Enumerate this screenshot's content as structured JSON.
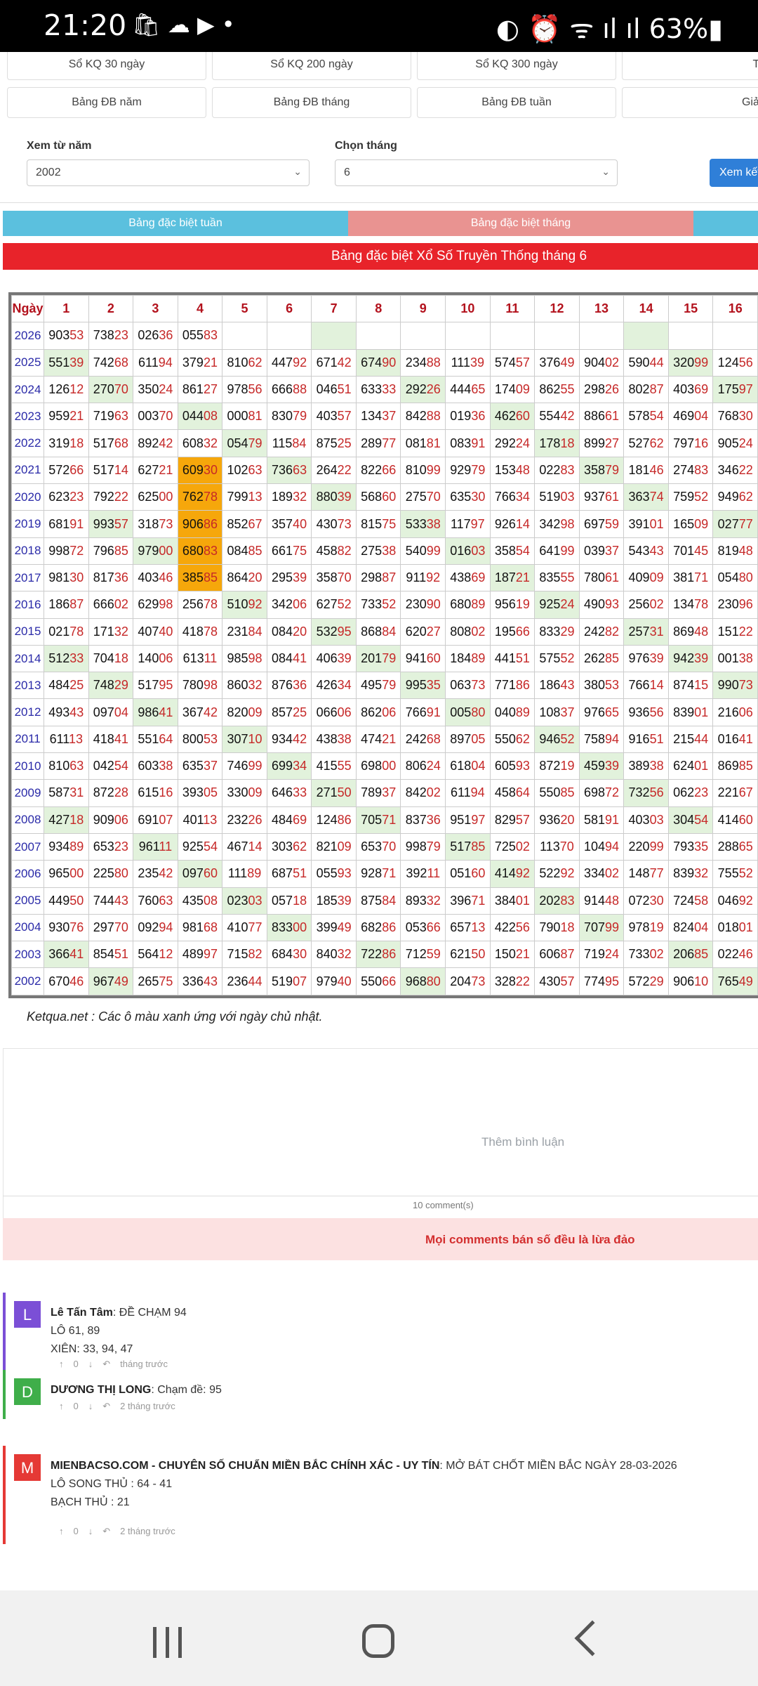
{
  "status_bar": {
    "time": "21:20",
    "left_icons": "🛍 ☁ ▶ •",
    "right_text": "◐ ⏰ ᯤ ıl ıl 63%▮"
  },
  "buttons_row1": [
    "Sổ KQ 30 ngày",
    "Sổ KQ 200 ngày",
    "Sổ KQ 300 ngày",
    "Tần suất loto"
  ],
  "buttons_row2": [
    "Bảng ĐB năm",
    "Bảng ĐB tháng",
    "Bảng ĐB tuần",
    "Giải ĐB ngày m"
  ],
  "filter": {
    "year_label": "Xem từ năm",
    "year_value": "2002",
    "month_label": "Chọn tháng",
    "month_value": "6",
    "go_label": "Xem kết"
  },
  "tabs": {
    "week": "Bảng đặc biệt tuần",
    "month": "Bảng đặc biệt tháng"
  },
  "banner": "Bảng đặc biệt Xổ Số Truyền Thống tháng 6",
  "colors": {
    "green_cell": "#e2f2dc",
    "orange_cell": "#f6a70b",
    "tab_blue": "#5bc0de",
    "tab_pink": "#e99391",
    "banner_red": "#e8232a"
  },
  "table": {
    "header": [
      "Ngày",
      "1",
      "2",
      "3",
      "4",
      "5",
      "6",
      "7",
      "8",
      "9",
      "10",
      "11",
      "12",
      "13",
      "14",
      "15",
      "16"
    ],
    "rows": [
      {
        "year": "2026",
        "values": [
          "90353",
          "73823",
          "02636",
          "05583",
          "",
          "",
          "",
          "",
          "",
          "",
          "",
          "",
          "",
          "",
          "",
          ""
        ],
        "green": [
          6,
          13
        ],
        "orange": []
      },
      {
        "year": "2025",
        "values": [
          "55139",
          "74268",
          "61194",
          "37921",
          "81062",
          "44792",
          "67142",
          "67490",
          "23488",
          "11139",
          "57457",
          "37649",
          "90402",
          "59044",
          "32099",
          "12456"
        ],
        "green": [
          0,
          7,
          14
        ],
        "orange": []
      },
      {
        "year": "2024",
        "values": [
          "12612",
          "27070",
          "35024",
          "86127",
          "97856",
          "66688",
          "04651",
          "63333",
          "29226",
          "44465",
          "17409",
          "86255",
          "29826",
          "80287",
          "40369",
          "17597"
        ],
        "green": [
          1,
          8,
          15
        ],
        "orange": []
      },
      {
        "year": "2023",
        "values": [
          "95921",
          "71963",
          "00370",
          "04408",
          "00081",
          "83079",
          "40357",
          "13437",
          "84288",
          "01936",
          "46260",
          "55442",
          "88661",
          "57854",
          "46904",
          "76830"
        ],
        "green": [
          3,
          10
        ],
        "orange": []
      },
      {
        "year": "2022",
        "values": [
          "31918",
          "51768",
          "89242",
          "60832",
          "05479",
          "11584",
          "87525",
          "28977",
          "08181",
          "08391",
          "29224",
          "17818",
          "89927",
          "52762",
          "79716",
          "90524"
        ],
        "green": [
          4,
          11
        ],
        "orange": []
      },
      {
        "year": "2021",
        "values": [
          "57266",
          "51714",
          "62721",
          "60930",
          "10263",
          "73663",
          "26422",
          "82266",
          "81099",
          "92979",
          "15348",
          "02283",
          "35879",
          "18146",
          "27483",
          "34622"
        ],
        "green": [
          5,
          12
        ],
        "orange": [
          3
        ]
      },
      {
        "year": "2020",
        "values": [
          "62323",
          "79222",
          "62500",
          "76278",
          "79913",
          "18932",
          "88039",
          "56860",
          "27570",
          "63530",
          "76634",
          "51903",
          "93761",
          "36374",
          "75952",
          "94962"
        ],
        "green": [
          6,
          13
        ],
        "orange": [
          3
        ]
      },
      {
        "year": "2019",
        "values": [
          "68191",
          "99357",
          "31873",
          "90686",
          "85267",
          "35740",
          "43073",
          "81575",
          "53338",
          "11797",
          "92614",
          "34298",
          "69759",
          "39101",
          "16509",
          "02777"
        ],
        "green": [
          1,
          8,
          15
        ],
        "orange": [
          3
        ]
      },
      {
        "year": "2018",
        "values": [
          "99872",
          "79685",
          "97900",
          "68083",
          "08485",
          "66175",
          "45882",
          "27538",
          "54099",
          "01603",
          "35854",
          "64199",
          "03937",
          "54343",
          "70145",
          "81948"
        ],
        "green": [
          2,
          9
        ],
        "orange": [
          3
        ]
      },
      {
        "year": "2017",
        "values": [
          "98130",
          "81736",
          "40346",
          "38585",
          "86420",
          "29539",
          "35870",
          "29887",
          "91192",
          "43869",
          "18721",
          "83555",
          "78061",
          "40909",
          "38171",
          "05480"
        ],
        "green": [
          10
        ],
        "orange": [
          3
        ]
      },
      {
        "year": "2016",
        "values": [
          "18687",
          "66602",
          "62998",
          "25678",
          "51092",
          "34206",
          "62752",
          "73352",
          "23090",
          "68089",
          "95619",
          "92524",
          "49093",
          "25602",
          "13478",
          "23096"
        ],
        "green": [
          4,
          11
        ],
        "orange": []
      },
      {
        "year": "2015",
        "values": [
          "02178",
          "17132",
          "40740",
          "41878",
          "23184",
          "08420",
          "53295",
          "86884",
          "62027",
          "80802",
          "19566",
          "83329",
          "24282",
          "25731",
          "86948",
          "15122"
        ],
        "green": [
          6,
          13
        ],
        "orange": []
      },
      {
        "year": "2014",
        "values": [
          "51233",
          "70418",
          "14006",
          "61311",
          "98598",
          "08441",
          "40639",
          "20179",
          "94160",
          "18489",
          "44151",
          "57552",
          "26285",
          "97639",
          "94239",
          "00138"
        ],
        "green": [
          0,
          7,
          14
        ],
        "orange": []
      },
      {
        "year": "2013",
        "values": [
          "48425",
          "74829",
          "51795",
          "78098",
          "86032",
          "87636",
          "42634",
          "49579",
          "99535",
          "06373",
          "77186",
          "18643",
          "38053",
          "76614",
          "87415",
          "99073"
        ],
        "green": [
          1,
          8,
          15
        ],
        "orange": []
      },
      {
        "year": "2012",
        "values": [
          "49343",
          "09704",
          "98641",
          "36742",
          "82009",
          "85725",
          "06606",
          "86206",
          "76691",
          "00580",
          "04089",
          "10837",
          "97665",
          "93656",
          "83901",
          "21606"
        ],
        "green": [
          2,
          9
        ],
        "orange": []
      },
      {
        "year": "2011",
        "values": [
          "61113",
          "41841",
          "55164",
          "80053",
          "30710",
          "93442",
          "43838",
          "47421",
          "24268",
          "89705",
          "55062",
          "94652",
          "75894",
          "91651",
          "21544",
          "01641"
        ],
        "green": [
          4,
          11
        ],
        "orange": []
      },
      {
        "year": "2010",
        "values": [
          "81063",
          "04254",
          "60338",
          "63537",
          "74699",
          "69934",
          "41555",
          "69800",
          "80624",
          "61804",
          "60593",
          "87219",
          "45939",
          "38938",
          "62401",
          "86985"
        ],
        "green": [
          5,
          12
        ],
        "orange": []
      },
      {
        "year": "2009",
        "values": [
          "58731",
          "87228",
          "61516",
          "39305",
          "33009",
          "64633",
          "27150",
          "78937",
          "84202",
          "61194",
          "45864",
          "55085",
          "69872",
          "73256",
          "06223",
          "22167"
        ],
        "green": [
          6,
          13
        ],
        "orange": []
      },
      {
        "year": "2008",
        "values": [
          "42718",
          "90906",
          "69107",
          "40113",
          "23226",
          "48469",
          "12486",
          "70571",
          "83736",
          "95197",
          "82957",
          "93620",
          "58191",
          "40303",
          "30454",
          "41460"
        ],
        "green": [
          0,
          7,
          14
        ],
        "orange": []
      },
      {
        "year": "2007",
        "values": [
          "93489",
          "65323",
          "96111",
          "92554",
          "46714",
          "30362",
          "82109",
          "65370",
          "99879",
          "51785",
          "72502",
          "11370",
          "10494",
          "22099",
          "79335",
          "28865"
        ],
        "green": [
          2,
          9
        ],
        "orange": []
      },
      {
        "year": "2006",
        "values": [
          "96500",
          "22580",
          "23542",
          "09760",
          "11189",
          "68751",
          "05593",
          "92871",
          "39211",
          "05160",
          "41492",
          "52292",
          "33402",
          "14877",
          "83932",
          "75552"
        ],
        "green": [
          3,
          10
        ],
        "orange": []
      },
      {
        "year": "2005",
        "values": [
          "44950",
          "74443",
          "76063",
          "43508",
          "02303",
          "05718",
          "18539",
          "87584",
          "89332",
          "39671",
          "38401",
          "20283",
          "91448",
          "07230",
          "72458",
          "04692"
        ],
        "green": [
          4,
          11
        ],
        "orange": []
      },
      {
        "year": "2004",
        "values": [
          "93076",
          "29770",
          "09294",
          "98168",
          "41077",
          "83300",
          "39949",
          "68286",
          "05366",
          "65713",
          "42256",
          "79018",
          "70799",
          "97819",
          "82404",
          "01801"
        ],
        "green": [
          5,
          12
        ],
        "orange": []
      },
      {
        "year": "2003",
        "values": [
          "36641",
          "85451",
          "56412",
          "48997",
          "71582",
          "68430",
          "84032",
          "72286",
          "71259",
          "62150",
          "15021",
          "60687",
          "71924",
          "73302",
          "20685",
          "02246"
        ],
        "green": [
          0,
          7,
          14
        ],
        "orange": []
      },
      {
        "year": "2002",
        "values": [
          "67046",
          "96749",
          "26575",
          "33643",
          "23644",
          "51907",
          "97940",
          "55066",
          "96880",
          "20473",
          "32822",
          "43057",
          "77495",
          "57229",
          "90610",
          "76549"
        ],
        "green": [
          1,
          8,
          15
        ],
        "orange": []
      }
    ]
  },
  "note": "Ketqua.net : Các ô màu xanh ứng với ngày chủ nhật.",
  "comments_section": {
    "add_comment": "Thêm bình luận",
    "count": "10 comment(s)",
    "warning": "Mọi comments bán số đều là lừa đảo"
  },
  "comments": [
    {
      "initial": "L",
      "color": "#7b4fd6",
      "author": "Lê Tấn Tâm",
      "text": ": ĐỀ CHẠM 94",
      "lines": [
        "LÔ 61, 89",
        "XIÊN: 33, 94, 47"
      ],
      "votes": "0",
      "time": "tháng trước"
    },
    {
      "initial": "D",
      "color": "#3fae4a",
      "author": "DƯƠNG THỊ LONG",
      "text": ": Chạm đề: 95",
      "lines": [],
      "votes": "0",
      "time": "2 tháng trước"
    },
    {
      "initial": "M",
      "color": "#e53935",
      "author": "MIENBACSO.COM - CHUYÊN SỐ CHUẨN MIỀN BẮC CHÍNH XÁC - UY TÍN",
      "text": ": MỞ BÁT CHỐT MIỀN BẮC NGÀY 28-03-2026",
      "lines": [
        "LÔ SONG THỦ : 64 - 41",
        "BẠCH THỦ : 21"
      ],
      "votes": "0",
      "time": "2 tháng trước"
    }
  ],
  "nav": {
    "recent": "recent-apps",
    "home": "home",
    "back": "back"
  }
}
